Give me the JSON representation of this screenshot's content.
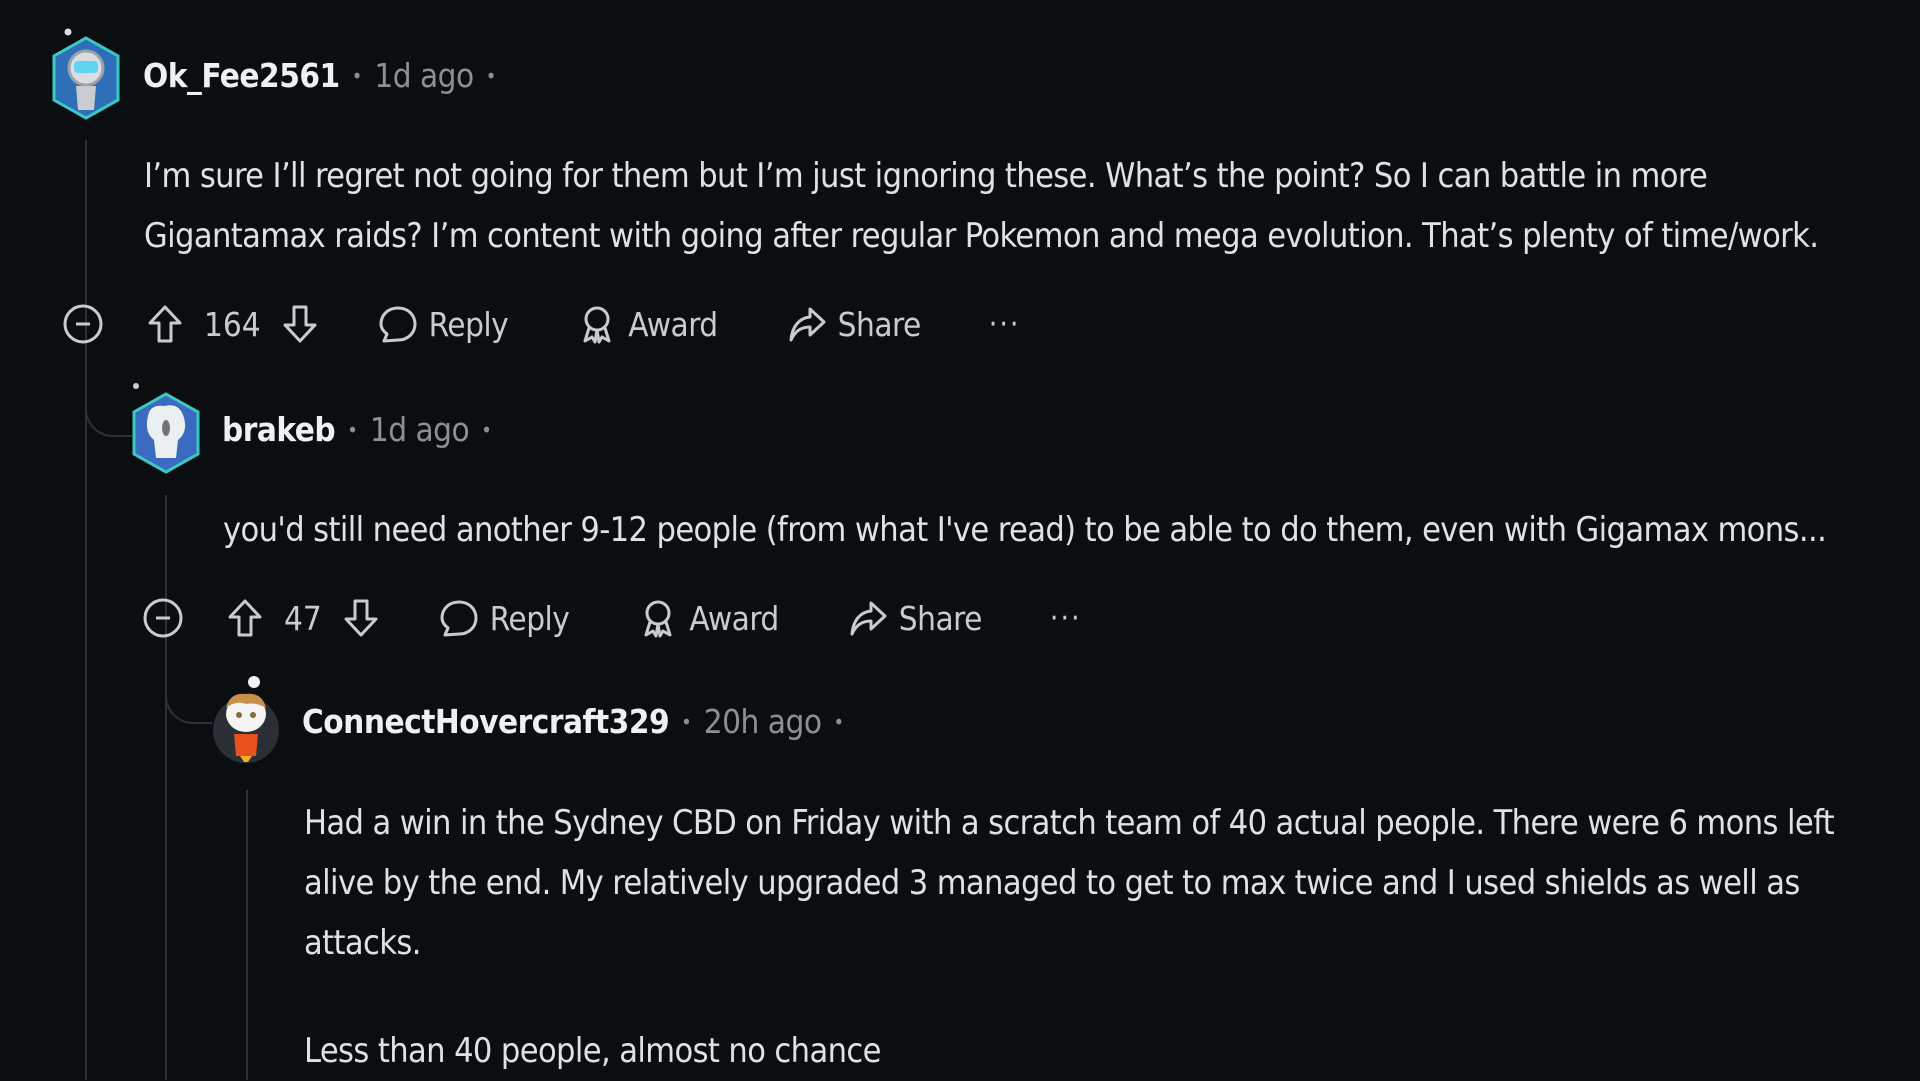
{
  "comments": [
    {
      "username": "Ok_Fee2561",
      "time": "1d ago",
      "avatar": "robot-hex-avatar",
      "body": [
        "I’m sure I’ll regret not going for them but I’m just ignoring these. What’s the point? So I can battle in more",
        "Gigantamax raids? I’m content with going after regular Pokemon and mega evolution. That’s plenty of time/work."
      ],
      "score": "164",
      "actions": {
        "reply": "Reply",
        "award": "Award",
        "share": "Share",
        "more": "···"
      }
    },
    {
      "username": "brakeb",
      "time": "1d ago",
      "avatar": "skull-hex-avatar",
      "body": [
        "you'd still need another 9-12 people (from what I've read) to be able to do them, even with Gigamax mons..."
      ],
      "score": "47",
      "actions": {
        "reply": "Reply",
        "award": "Award",
        "share": "Share",
        "more": "···"
      }
    },
    {
      "username": "ConnectHovercraft329",
      "time": "20h ago",
      "avatar": "snoo-avatar",
      "body": [
        "Had a win in the Sydney CBD on Friday with a scratch team of 40 actual people. There were 6 mons left",
        "alive by the end. My relatively upgraded 3 managed to get to max twice and I used shields as well as",
        "attacks.",
        "",
        "Less than 40 people, almost no chance"
      ]
    }
  ],
  "colors": {
    "background": "#0b0e11",
    "thread_line": "#2c3137",
    "text": "#dfe2e4",
    "meta": "#8a9196"
  }
}
